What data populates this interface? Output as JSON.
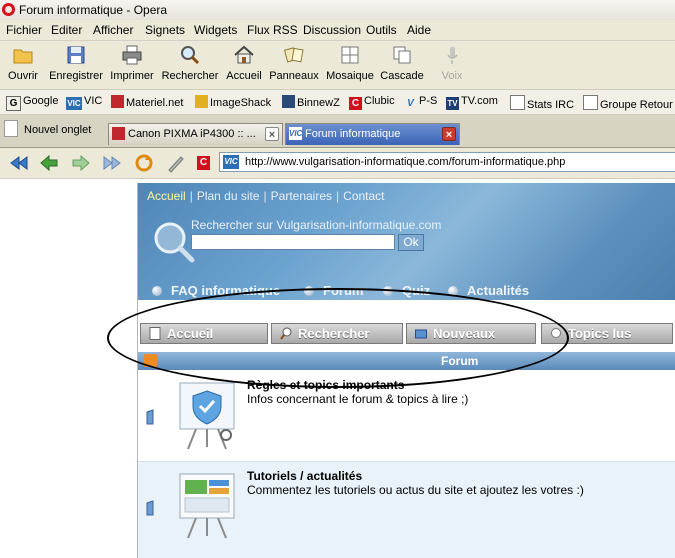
{
  "window": {
    "title": "Forum informatique - Opera"
  },
  "menu": [
    "Fichier",
    "Editer",
    "Afficher",
    "Signets",
    "Widgets",
    "Flux RSS",
    "Discussion",
    "Outils",
    "Aide"
  ],
  "toolbar": [
    {
      "label": "Ouvrir",
      "icon": "folder-icon"
    },
    {
      "label": "Enregistrer",
      "icon": "floppy-icon"
    },
    {
      "label": "Imprimer",
      "icon": "printer-icon"
    },
    {
      "label": "Rechercher",
      "icon": "magnifier-icon"
    },
    {
      "label": "Accueil",
      "icon": "home-icon"
    },
    {
      "label": "Panneaux",
      "icon": "panels-icon"
    },
    {
      "label": "Mosaique",
      "icon": "tile-icon"
    },
    {
      "label": "Cascade",
      "icon": "cascade-icon"
    },
    {
      "label": "Voix",
      "icon": "voice-icon",
      "disabled": true
    }
  ],
  "bookmarks": [
    "Google",
    "VIC",
    "Materiel.net",
    "ImageShack",
    "BinnewZ",
    "Clubic",
    "P-S",
    "TV.com",
    "Stats IRC",
    "Groupe Retour"
  ],
  "tabs": {
    "new_tab": "Nouvel onglet",
    "items": [
      {
        "label": "Canon PIXMA iP4300 :: ...",
        "active": false
      },
      {
        "label": "Forum informatique",
        "active": true
      }
    ]
  },
  "address": {
    "url": "http://www.vulgarisation-informatique.com/forum-informatique.php",
    "logo": "VIC"
  },
  "site": {
    "topnav": [
      "Accueil",
      "Plan du site",
      "Partenaires",
      "Contact"
    ],
    "search_label": "Rechercher sur Vulgarisation-informatique.com",
    "search_value": "",
    "search_button": "Ok",
    "subnav": [
      "FAQ informatique",
      "Forum",
      "Quiz",
      "Actualités"
    ],
    "forum_tabs": [
      "Accueil",
      "Rechercher",
      "Nouveaux",
      "Topics lus"
    ],
    "forum_header": "Forum",
    "forums": [
      {
        "title": "Règles et topics importants",
        "desc": "Infos concernant le forum & topics à lire ;)"
      },
      {
        "title": "Tutoriels / actualités",
        "desc": "Commentez les tutoriels ou actus du site et ajoutez les votres :)"
      }
    ]
  },
  "colors": {
    "accent": "#3b64b6",
    "header_blue": "#6da3cf",
    "close_red": "#ce3b2c",
    "active_link": "#fff4a0"
  }
}
